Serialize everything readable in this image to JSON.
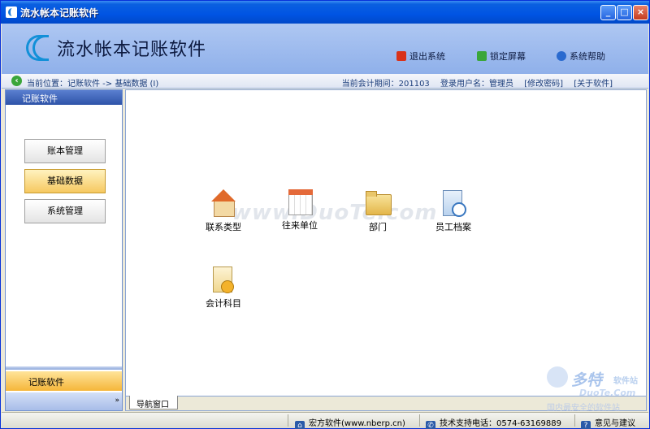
{
  "window": {
    "title": "流水帐本记账软件",
    "controls": [
      "_",
      "□",
      "×"
    ]
  },
  "header": {
    "app_name": "流水帐本记账软件",
    "actions": [
      {
        "label": "退出系统",
        "icon": "exit-icon",
        "color": "#d9321a"
      },
      {
        "label": "锁定屏幕",
        "icon": "lock-icon",
        "color": "#3aa63a"
      },
      {
        "label": "系统帮助",
        "icon": "help-icon",
        "color": "#2a6acf"
      }
    ]
  },
  "breadcrumb": {
    "text": "当前位置：记账软件 -> 基础数据 (I)",
    "period_label": "当前会计期间：201103",
    "user_label": "登录用户名：管理员",
    "change_password": "[修改密码]",
    "about": "[关于软件]"
  },
  "sidebar": {
    "header": "记账软件",
    "buttons": [
      {
        "label": "账本管理",
        "active": false
      },
      {
        "label": "基础数据",
        "active": true
      },
      {
        "label": "系统管理",
        "active": false
      }
    ],
    "section": "记账软件",
    "collapse_glyph": "»"
  },
  "main": {
    "watermark": "www.DuoTe.com",
    "tiles": [
      {
        "label": "联系类型",
        "icon": "house-icon"
      },
      {
        "label": "往来单位",
        "icon": "calendar-icon"
      },
      {
        "label": "部门",
        "icon": "folder-icon"
      },
      {
        "label": "员工档案",
        "icon": "employee-doc-icon"
      },
      {
        "label": "会计科目",
        "icon": "account-coin-icon"
      }
    ],
    "tab": "导航窗口"
  },
  "corner_watermark": {
    "brand": "多特",
    "tag": "软件站",
    "site": "DuoTe.Com",
    "slogan": "国内最安全的软件站"
  },
  "statusbar": {
    "company": "宏方软件(www.nberp.cn)",
    "support": "技术支持电话：0574-63169889",
    "feedback": "意见与建议"
  }
}
